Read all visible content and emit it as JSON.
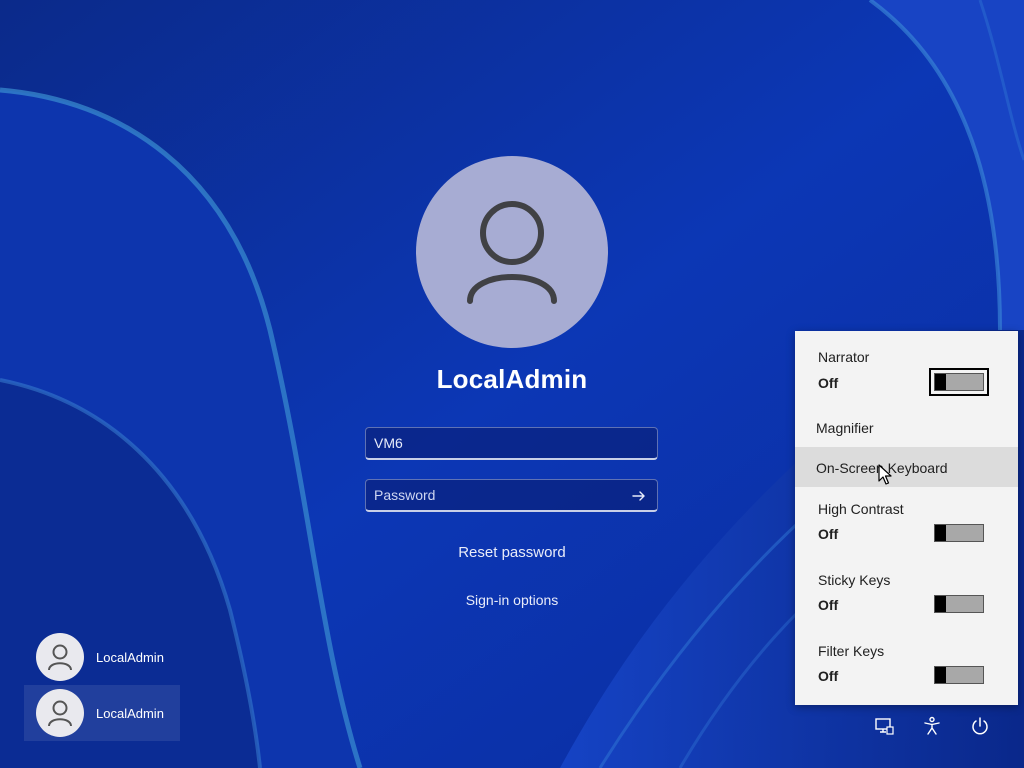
{
  "login": {
    "username": "LocalAdmin",
    "user_field_value": "VM6",
    "password_placeholder": "Password",
    "reset_password": "Reset password",
    "sign_in_options": "Sign-in options"
  },
  "users": [
    {
      "name": "LocalAdmin",
      "selected": false
    },
    {
      "name": "LocalAdmin",
      "selected": true
    }
  ],
  "accessibility_panel": {
    "narrator": {
      "label": "Narrator",
      "state": "Off"
    },
    "magnifier": {
      "label": "Magnifier"
    },
    "on_screen_keyboard": {
      "label": "On-Screen Keyboard"
    },
    "high_contrast": {
      "label": "High Contrast",
      "state": "Off"
    },
    "sticky_keys": {
      "label": "Sticky Keys",
      "state": "Off"
    },
    "filter_keys": {
      "label": "Filter Keys",
      "state": "Off"
    }
  },
  "system_tray": {
    "icons": [
      "network-icon",
      "accessibility-icon",
      "power-icon"
    ]
  },
  "colors": {
    "wallpaper_base": "#0a2f9c",
    "avatar_bg": "#a7acd3",
    "panel_bg": "#f3f3f3",
    "panel_hover": "#dcdcdc"
  }
}
